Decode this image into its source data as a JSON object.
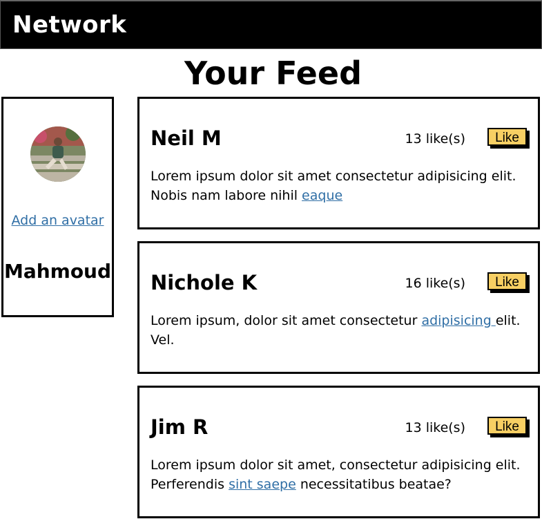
{
  "navbar": {
    "brand": "Network"
  },
  "page": {
    "title": "Your Feed"
  },
  "profile": {
    "add_avatar_label": "Add an avatar",
    "username": "Mahmoud"
  },
  "posts": [
    {
      "author": "Neil M",
      "likes": "13 like(s)",
      "like_label": "Like",
      "body_before": "Lorem ipsum dolor sit amet consectetur adipisicing elit. Nobis nam labore nihil ",
      "link": "eaque",
      "body_after": ""
    },
    {
      "author": "Nichole K",
      "likes": "16 like(s)",
      "like_label": "Like",
      "body_before": "Lorem ipsum, dolor sit amet consectetur ",
      "link": "adipisicing ",
      "body_after": "elit. Vel."
    },
    {
      "author": "Jim R",
      "likes": "13 like(s)",
      "like_label": "Like",
      "body_before": "Lorem ipsum dolor sit amet, consectetur adipisicing elit. Perferendis ",
      "link": "sint saepe",
      "body_after": " necessitatibus beatae?"
    }
  ],
  "colors": {
    "navbar_bg": "#000000",
    "link": "#2f6ea5",
    "like_button": "#f7cf63"
  }
}
